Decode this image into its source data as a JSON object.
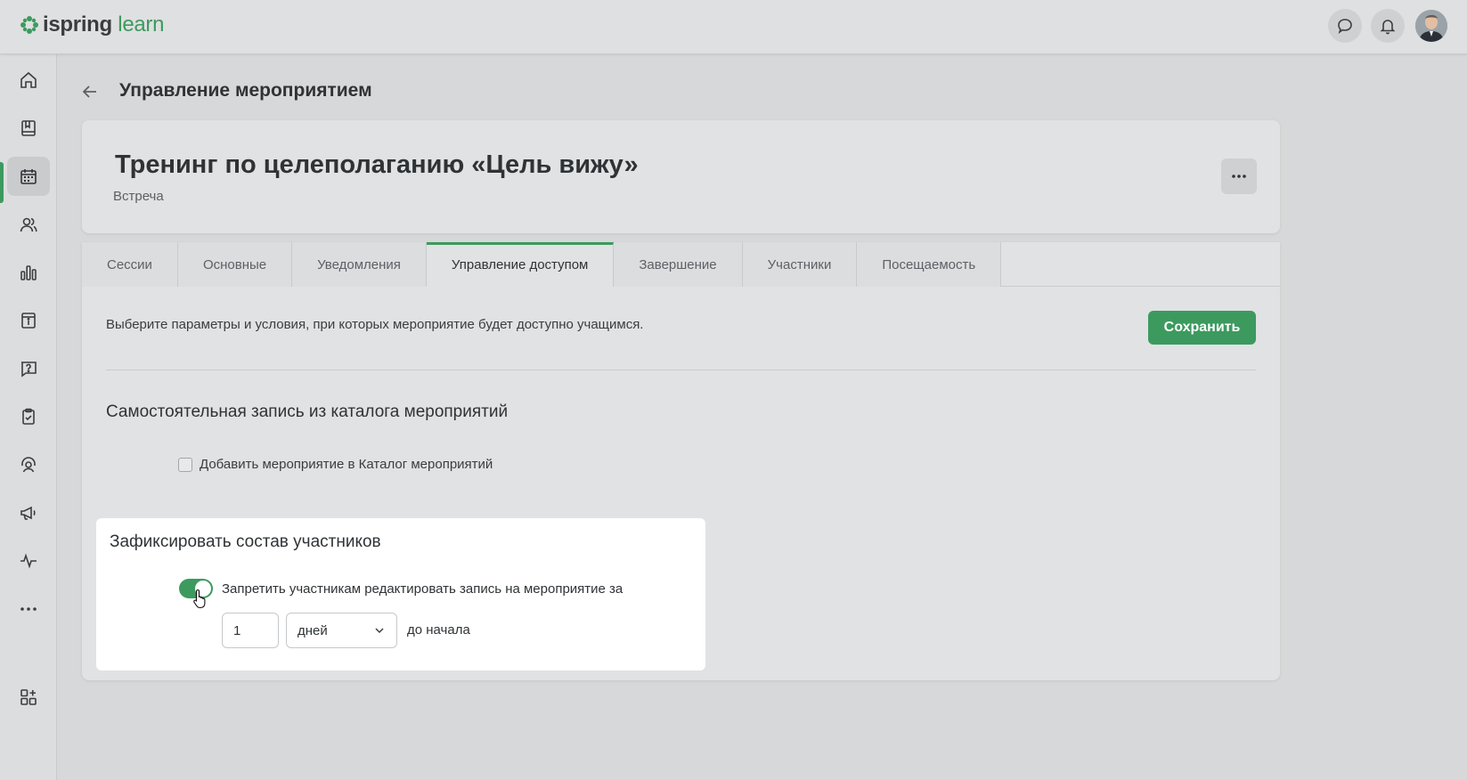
{
  "brand": {
    "name_part1": "ispring",
    "name_part2": "learn",
    "accent": "#3c9a5f"
  },
  "topbar": {
    "icons": [
      "chat-icon",
      "bell-icon",
      "user-avatar"
    ]
  },
  "sidebar": {
    "items": [
      {
        "icon": "home-icon"
      },
      {
        "icon": "book-icon"
      },
      {
        "icon": "calendar-icon",
        "active": true
      },
      {
        "icon": "users-icon"
      },
      {
        "icon": "chart-icon"
      },
      {
        "icon": "info-icon"
      },
      {
        "icon": "question-icon"
      },
      {
        "icon": "clipboard-check-icon"
      },
      {
        "icon": "support-icon"
      },
      {
        "icon": "megaphone-icon"
      },
      {
        "icon": "activity-icon"
      },
      {
        "icon": "more-icon"
      },
      {
        "icon": "apps-add-icon"
      }
    ]
  },
  "page": {
    "title": "Управление мероприятием"
  },
  "event": {
    "title": "Тренинг по целеполаганию «Цель вижу»",
    "type": "Встреча"
  },
  "tabs": [
    {
      "label": "Сессии"
    },
    {
      "label": "Основные"
    },
    {
      "label": "Уведомления"
    },
    {
      "label": "Управление доступом",
      "active": true
    },
    {
      "label": "Завершение"
    },
    {
      "label": "Участники"
    },
    {
      "label": "Посещаемость"
    }
  ],
  "access": {
    "description": "Выберите параметры и условия, при которых мероприятие будет доступно учащимся.",
    "save_label": "Сохранить",
    "catalog_section_title": "Самостоятельная запись из каталога мероприятий",
    "catalog_checkbox_label": "Добавить мероприятие в Каталог мероприятий",
    "catalog_checkbox_checked": false,
    "fix_section_title": "Зафиксировать состав участников",
    "fix_toggle_label": "Запретить участникам редактировать запись на мероприятие за",
    "fix_toggle_on": true,
    "days_value": "1",
    "unit_value": "дней",
    "before_start_label": "до начала"
  }
}
